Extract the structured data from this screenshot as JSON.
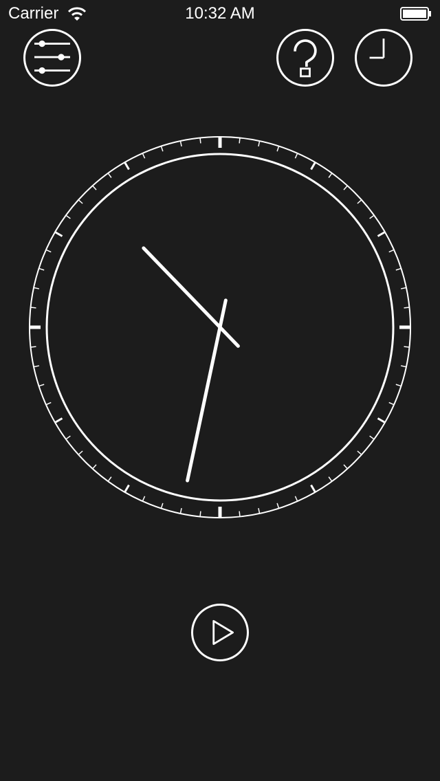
{
  "status_bar": {
    "carrier": "Carrier",
    "time": "10:32 AM",
    "wifi_icon": "wifi-icon",
    "battery_icon": "battery-icon"
  },
  "toolbar": {
    "settings_icon": "sliders-icon",
    "help_icon": "question-mark-icon",
    "clock_icon": "clock-icon"
  },
  "clock": {
    "hour": 10,
    "minute": 32,
    "hand_color": "#ffffff",
    "background_color": "#1c1c1c"
  },
  "controls": {
    "play_icon": "play-icon"
  }
}
